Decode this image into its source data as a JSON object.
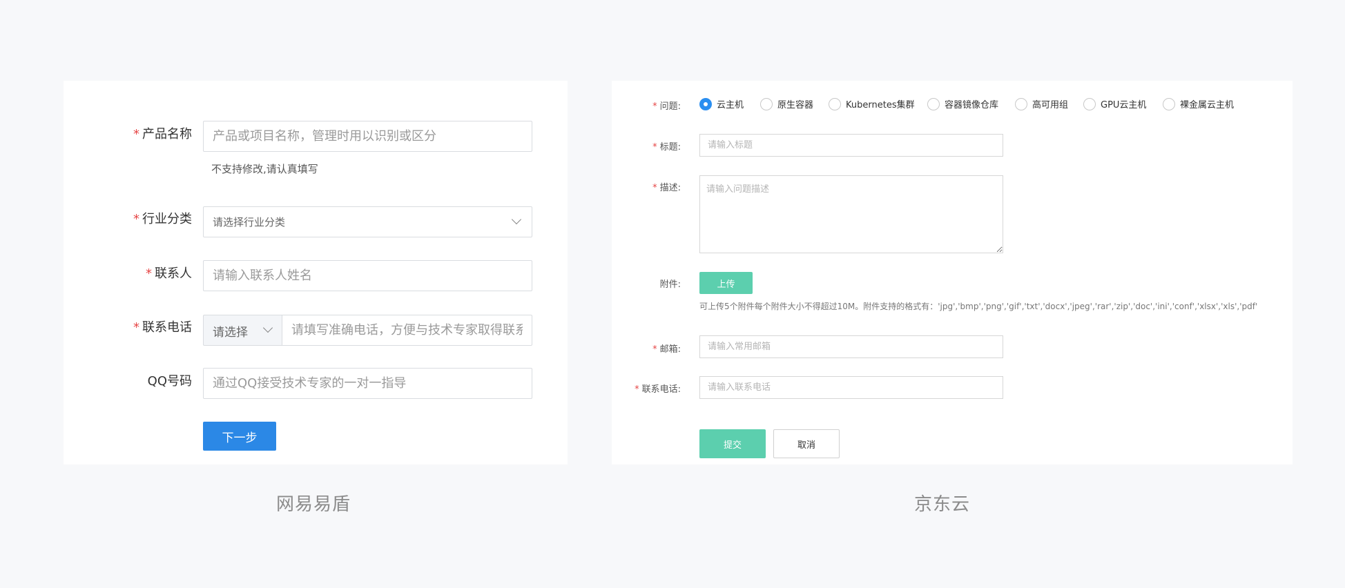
{
  "left_form": {
    "caption": "网易易盾",
    "required_mark": "*",
    "product_name": {
      "label": "产品名称",
      "placeholder": "产品或项目名称，管理时用以识别或区分",
      "hint": "不支持修改,请认真填写"
    },
    "industry": {
      "label": "行业分类",
      "placeholder": "请选择行业分类"
    },
    "contact": {
      "label": "联系人",
      "placeholder": "请输入联系人姓名"
    },
    "phone": {
      "label": "联系电话",
      "prefix_select": "请选择",
      "placeholder": "请填写准确电话，方便与技术专家取得联系"
    },
    "qq": {
      "label": "QQ号码",
      "placeholder": "通过QQ接受技术专家的一对一指导"
    },
    "next_button": "下一步"
  },
  "right_form": {
    "caption": "京东云",
    "required_mark": "*",
    "problem": {
      "label": "问题:",
      "options": [
        "云主机",
        "原生容器",
        "Kubernetes集群",
        "容器镜像仓库",
        "高可用组",
        "GPU云主机",
        "裸金属云主机"
      ],
      "selected": "云主机"
    },
    "title": {
      "label": "标题:",
      "placeholder": "请输入标题"
    },
    "description": {
      "label": "描述:",
      "placeholder": "请输入问题描述"
    },
    "attachment": {
      "label": "附件:",
      "upload_button": "上传",
      "note": "可上传5个附件每个附件大小不得超过10M。附件支持的格式有：'jpg','bmp','png','gif','txt','docx','jpeg','rar','zip','doc','ini','conf','xlsx','xls','pdf'"
    },
    "email": {
      "label": "邮箱:",
      "placeholder": "请输入常用邮箱"
    },
    "phone": {
      "label": "联系电话:",
      "placeholder": "请输入联系电话"
    },
    "submit_button": "提交",
    "cancel_button": "取消"
  },
  "colors": {
    "primary_blue": "#2b88e6",
    "radio_blue": "#2a8ef0",
    "jd_green": "#5ccfae",
    "required_red": "#e64545",
    "page_bg": "#f7f8fa"
  }
}
